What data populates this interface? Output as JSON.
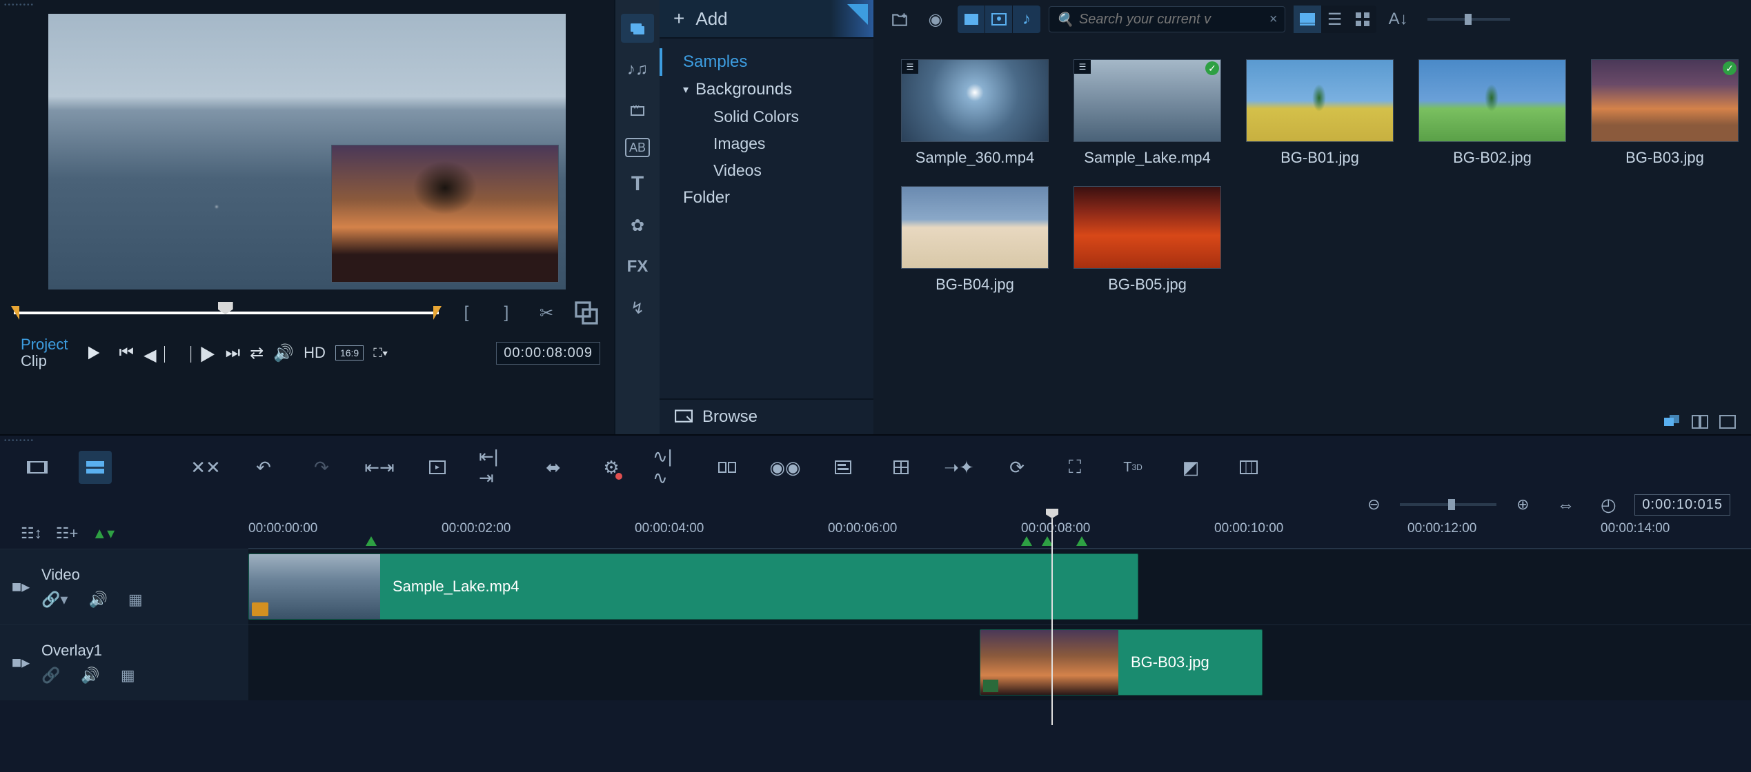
{
  "preview": {
    "mode_project": "Project",
    "mode_clip": "Clip",
    "hd_label": "HD",
    "aspect": "16:9",
    "timecode": "00:00:08:009"
  },
  "library": {
    "add_label": "Add",
    "browse_label": "Browse",
    "search_placeholder": "Search your current v",
    "tree": {
      "samples": "Samples",
      "backgrounds": "Backgrounds",
      "solid_colors": "Solid Colors",
      "images": "Images",
      "videos": "Videos",
      "folder": "Folder"
    },
    "items": [
      {
        "label": "Sample_360.mp4",
        "thumb": "th-360",
        "video": true,
        "checked": false
      },
      {
        "label": "Sample_Lake.mp4",
        "thumb": "th-lake",
        "video": true,
        "checked": true
      },
      {
        "label": "BG-B01.jpg",
        "thumb": "th-b01",
        "video": false,
        "checked": false
      },
      {
        "label": "BG-B02.jpg",
        "thumb": "th-b02",
        "video": false,
        "checked": false
      },
      {
        "label": "BG-B03.jpg",
        "thumb": "th-b03",
        "video": false,
        "checked": true
      },
      {
        "label": "BG-B04.jpg",
        "thumb": "th-b04",
        "video": false,
        "checked": false
      },
      {
        "label": "BG-B05.jpg",
        "thumb": "th-b05",
        "video": false,
        "checked": false
      }
    ]
  },
  "timeline": {
    "timecode": "0:00:10:015",
    "ruler": [
      "00:00:00:00",
      "00:00:02:00",
      "00:00:04:00",
      "00:00:06:00",
      "00:00:08:00",
      "00:00:10:00",
      "00:00:12:00",
      "00:00:14:00"
    ],
    "tracks": {
      "video": {
        "name": "Video",
        "clip_label": "Sample_Lake.mp4"
      },
      "overlay1": {
        "name": "Overlay1",
        "clip_label": "BG-B03.jpg"
      }
    }
  }
}
